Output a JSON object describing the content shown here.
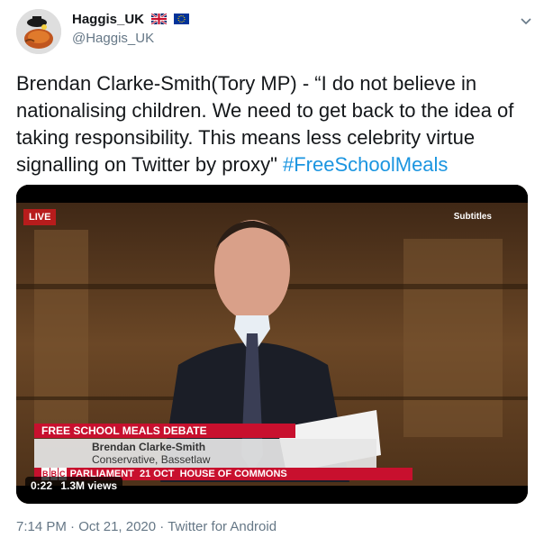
{
  "author": {
    "display_name": "Haggis_UK",
    "handle": "@Haggis_UK",
    "flags": [
      "uk-flag-icon",
      "eu-flag-icon"
    ]
  },
  "tweet": {
    "text": "Brendan Clarke-Smith(Tory MP) - “I do not believe in nationalising children. We need to get back to the idea of taking responsibility. This means less celebrity virtue signalling on Twitter by proxy\" ",
    "hashtag": "#FreeSchoolMeals"
  },
  "video": {
    "live_label": "LIVE",
    "subtitles_label": "Subtitles",
    "lower_third_title": "FREE SCHOOL MEALS DEBATE",
    "speaker_name": "Brendan Clarke-Smith",
    "speaker_role": "Conservative, Bassetlaw",
    "bbc_letters": [
      "B",
      "B",
      "C"
    ],
    "channel_line": "PARLIAMENT  21 OCT  HOUSE OF COMMONS",
    "duration": "0:22",
    "views": "1.3M views"
  },
  "meta": {
    "time": "7:14 PM",
    "separator": " · ",
    "date": "Oct 21, 2020",
    "source": "Twitter for Android"
  },
  "colors": {
    "link": "#1b95e0",
    "muted": "#657786",
    "bbc_red": "#c8102e"
  }
}
